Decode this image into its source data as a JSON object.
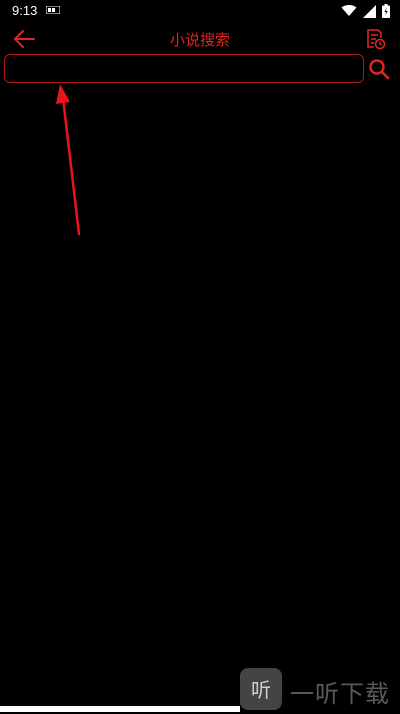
{
  "status_bar": {
    "time": "9:13",
    "icons": [
      "notification-icon",
      "wifi-icon",
      "signal-icon",
      "battery-icon"
    ]
  },
  "header": {
    "title": "小说搜索",
    "back_icon": "arrow-left-icon",
    "history_icon": "history-icon"
  },
  "search": {
    "value": "",
    "placeholder": "",
    "button_icon": "search-icon"
  },
  "annotation": {
    "arrow_icon": "red-arrow-icon"
  },
  "watermark": {
    "logo_glyph": "听",
    "text": "一听下载"
  },
  "colors": {
    "accent": "#e12424",
    "input_border": "#b01818",
    "background": "#000000"
  }
}
